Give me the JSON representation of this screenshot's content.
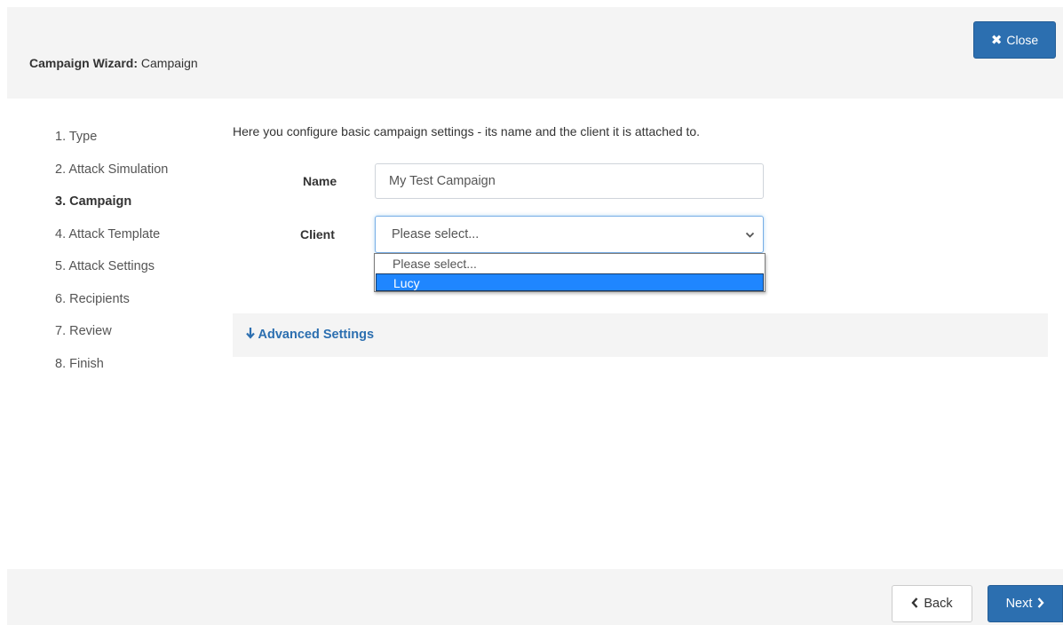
{
  "header": {
    "title_bold": "Campaign Wizard:",
    "title_rest": "Campaign",
    "close_label": "Close"
  },
  "steps": [
    {
      "label": "1. Type"
    },
    {
      "label": "2. Attack Simulation"
    },
    {
      "label": "3. Campaign",
      "active": true
    },
    {
      "label": "4. Attack Template"
    },
    {
      "label": "5. Attack Settings"
    },
    {
      "label": "6. Recipients"
    },
    {
      "label": "7. Review"
    },
    {
      "label": "8. Finish"
    }
  ],
  "main": {
    "intro": "Here you configure basic campaign settings - its name and the client it is attached to.",
    "name_label": "Name",
    "name_value": "My Test Campaign",
    "client_label": "Client",
    "client_value": "Please select...",
    "client_options": [
      "Please select...",
      "Lucy"
    ],
    "client_highlighted_option": "Lucy",
    "advanced_label": "Advanced Settings"
  },
  "footer": {
    "back_label": "Back",
    "next_label": "Next"
  },
  "icons": {
    "close": "times-icon",
    "select": "chevron-down-icon",
    "advanced": "arrow-down-icon",
    "back": "chevron-left-icon",
    "next": "chevron-right-icon"
  },
  "colors": {
    "primary": "#2c6fb0",
    "highlight": "#1f86ff",
    "panel": "#f4f4f4"
  }
}
